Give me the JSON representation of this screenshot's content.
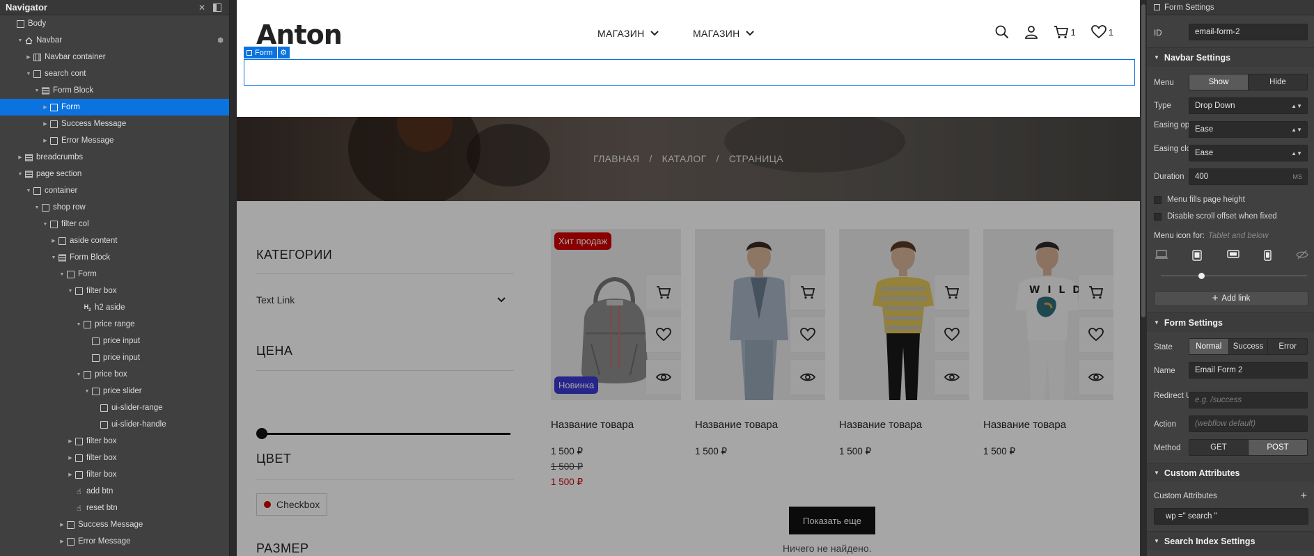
{
  "navigator": {
    "title": "Navigator",
    "items": [
      {
        "label": "Body",
        "depth": 0,
        "icon": "body",
        "toggle": ""
      },
      {
        "label": "Navbar",
        "depth": 1,
        "icon": "navbar",
        "toggle": "open",
        "extra": "symbol"
      },
      {
        "label": "Navbar container",
        "depth": 2,
        "icon": "container",
        "toggle": "closed"
      },
      {
        "label": "search cont",
        "depth": 2,
        "icon": "box",
        "toggle": "open"
      },
      {
        "label": "Form Block",
        "depth": 3,
        "icon": "form",
        "toggle": "open"
      },
      {
        "label": "Form",
        "depth": 4,
        "icon": "box",
        "toggle": "closed",
        "selected": true
      },
      {
        "label": "Success Message",
        "depth": 4,
        "icon": "box",
        "toggle": "closed"
      },
      {
        "label": "Error Message",
        "depth": 4,
        "icon": "box",
        "toggle": "closed"
      },
      {
        "label": "breadcrumbs",
        "depth": 1,
        "icon": "section",
        "toggle": "closed"
      },
      {
        "label": "page section",
        "depth": 1,
        "icon": "section",
        "toggle": "open"
      },
      {
        "label": "container",
        "depth": 2,
        "icon": "box",
        "toggle": "open"
      },
      {
        "label": "shop row",
        "depth": 3,
        "icon": "box",
        "toggle": "open"
      },
      {
        "label": "filter col",
        "depth": 4,
        "icon": "box",
        "toggle": "open"
      },
      {
        "label": "aside content",
        "depth": 5,
        "icon": "box",
        "toggle": "closed"
      },
      {
        "label": "Form Block",
        "depth": 5,
        "icon": "form",
        "toggle": "open"
      },
      {
        "label": "Form",
        "depth": 6,
        "icon": "box",
        "toggle": "open"
      },
      {
        "label": "filter box",
        "depth": 7,
        "icon": "box",
        "toggle": "open"
      },
      {
        "label": "h2 aside",
        "depth": 8,
        "icon": "heading",
        "toggle": ""
      },
      {
        "label": "price range",
        "depth": 8,
        "icon": "box",
        "toggle": "open"
      },
      {
        "label": "price input",
        "depth": 9,
        "icon": "box",
        "toggle": ""
      },
      {
        "label": "price input",
        "depth": 9,
        "icon": "box",
        "toggle": ""
      },
      {
        "label": "price box",
        "depth": 8,
        "icon": "box",
        "toggle": "open"
      },
      {
        "label": "price slider",
        "depth": 9,
        "icon": "box",
        "toggle": "open"
      },
      {
        "label": "ui-slider-range",
        "depth": 10,
        "icon": "box",
        "toggle": ""
      },
      {
        "label": "ui-slider-handle",
        "depth": 10,
        "icon": "box",
        "toggle": ""
      },
      {
        "label": "filter box",
        "depth": 7,
        "icon": "box",
        "toggle": "closed"
      },
      {
        "label": "filter box",
        "depth": 7,
        "icon": "box",
        "toggle": "closed"
      },
      {
        "label": "filter box",
        "depth": 7,
        "icon": "box",
        "toggle": "closed"
      },
      {
        "label": "add btn",
        "depth": 7,
        "icon": "hand",
        "toggle": ""
      },
      {
        "label": "reset btn",
        "depth": 7,
        "icon": "hand",
        "toggle": ""
      },
      {
        "label": "Success Message",
        "depth": 6,
        "icon": "box",
        "toggle": "closed"
      },
      {
        "label": "Error Message",
        "depth": 6,
        "icon": "box",
        "toggle": "closed"
      }
    ]
  },
  "canvas": {
    "logo": "Anton",
    "menu": [
      {
        "label": "МАГАЗИН"
      },
      {
        "label": "МАГАЗИН"
      }
    ],
    "cart_count": "1",
    "wish_count": "1",
    "form_tag": "Form",
    "breadcrumb": [
      "ГЛАВНАЯ",
      "/",
      "КАТАЛОГ",
      "/",
      "СТРАНИЦА"
    ],
    "aside": {
      "categories": "КАТЕГОРИИ",
      "text_link": "Text Link",
      "price": "ЦЕНА",
      "color": "ЦВЕТ",
      "checkbox": "Checkbox",
      "size": "РАЗМЕР",
      "slider_position": 0
    },
    "products": [
      {
        "name": "Название товара",
        "price": "1 500 ₽",
        "old_price": "1 500 ₽",
        "sale_price": "1 500 ₽",
        "badge_top": "Хит продаж",
        "badge_bottom": "Новинка",
        "image": "backpack"
      },
      {
        "name": "Название товара",
        "price": "1 500 ₽",
        "image": "man-blazer"
      },
      {
        "name": "Название товара",
        "price": "1 500 ₽",
        "image": "man-striped-tee"
      },
      {
        "name": "Название товара",
        "price": "1 500 ₽",
        "image": "man-print-tee"
      }
    ],
    "show_more": "Показать еще",
    "empty_message": "Ничего не найдено."
  },
  "settings": {
    "form_settings_header": "Form Settings",
    "id_label": "ID",
    "id_value": "email-form-2",
    "navbar_settings": "Navbar Settings",
    "menu_label": "Menu",
    "menu_options": [
      "Show",
      "Hide"
    ],
    "menu_active": "Show",
    "type_label": "Type",
    "type_value": "Drop Down",
    "easing_open_label": "Easing open",
    "easing_open_value": "Ease",
    "easing_close_label": "Easing close",
    "easing_close_value": "Ease",
    "duration_label": "Duration",
    "duration_value": "400",
    "duration_unit": "MS",
    "menu_fills": "Menu fills page height",
    "disable_scroll": "Disable scroll offset when fixed",
    "menu_icon_for": "Menu icon for:",
    "menu_icon_for_value": "Tablet and below",
    "add_link": "Add link",
    "form_settings": "Form Settings",
    "state_label": "State",
    "state_options": [
      "Normal",
      "Success",
      "Error"
    ],
    "state_active": "Normal",
    "name_label": "Name",
    "name_value": "Email Form 2",
    "redirect_label": "Redirect URL",
    "redirect_placeholder": "e.g. /success",
    "action_label": "Action",
    "action_placeholder": "(webflow default)",
    "method_label": "Method",
    "method_options": [
      "GET",
      "POST"
    ],
    "method_active": "POST",
    "custom_attributes_header": "Custom Attributes",
    "custom_attributes_label": "Custom Attributes",
    "custom_attribute": "wp =\" search \"",
    "search_index": "Search Index Settings"
  },
  "colors": {
    "accent": "#0b73e0",
    "panel": "#404040",
    "badge_red": "#d40000",
    "badge_blue": "#3a3ad6",
    "sale": "#d40000"
  }
}
